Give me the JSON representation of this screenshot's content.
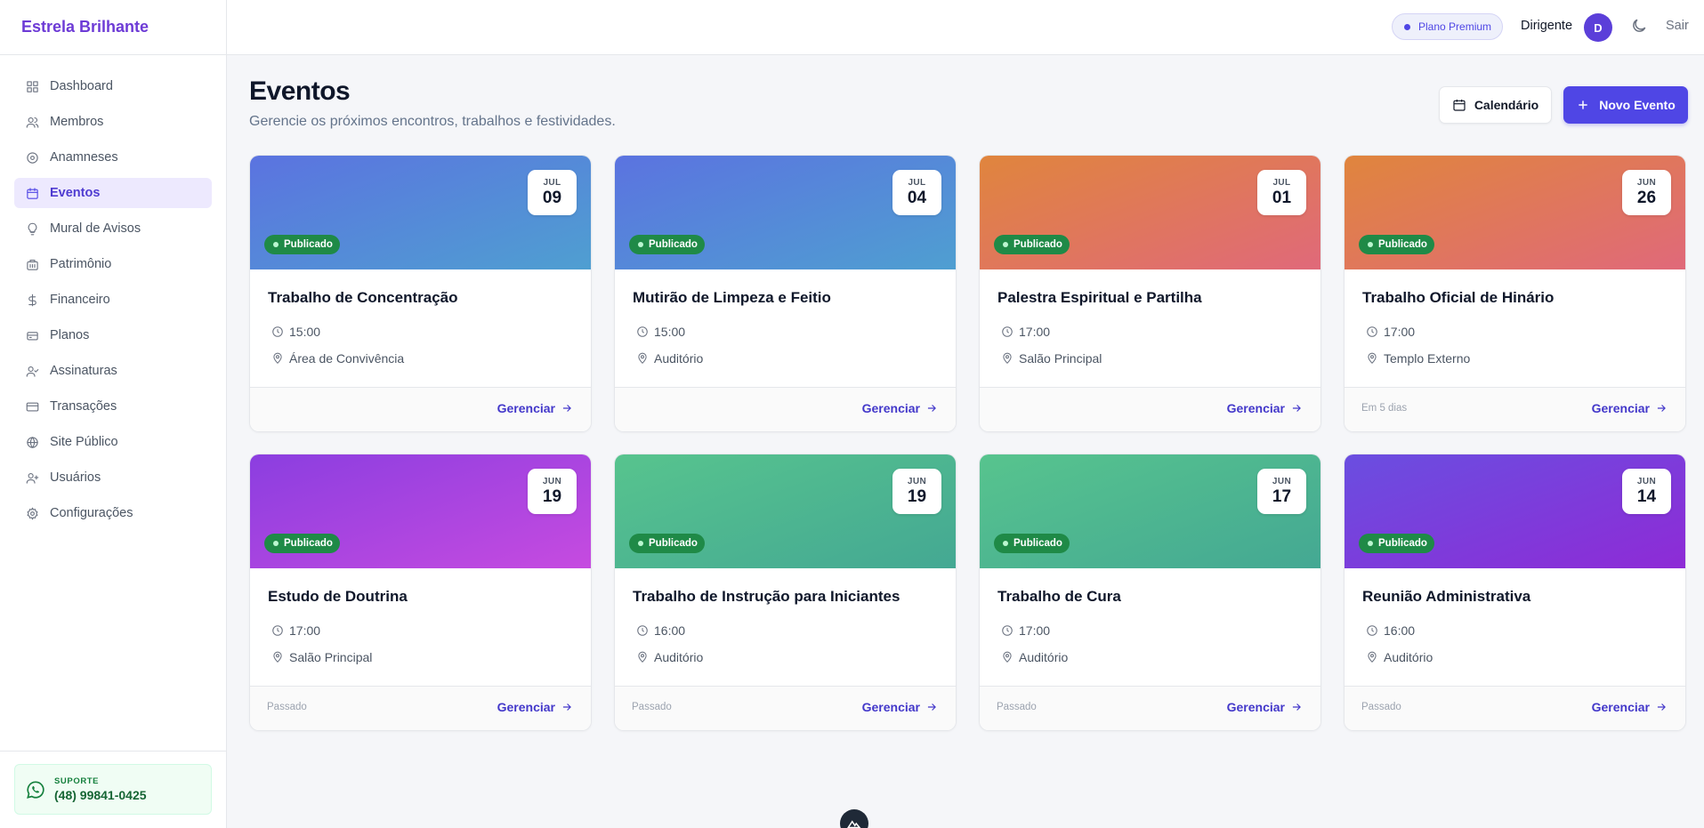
{
  "app": {
    "brand": "Estrela Brilhante"
  },
  "sidebar": {
    "items": [
      {
        "label": "Dashboard",
        "icon": "dashboard-icon"
      },
      {
        "label": "Membros",
        "icon": "users-icon"
      },
      {
        "label": "Anamneses",
        "icon": "clipboard-icon"
      },
      {
        "label": "Eventos",
        "icon": "calendar-icon",
        "active": true
      },
      {
        "label": "Mural de Avisos",
        "icon": "lightbulb-icon"
      },
      {
        "label": "Patrimônio",
        "icon": "building-icon"
      },
      {
        "label": "Financeiro",
        "icon": "dollar-icon"
      },
      {
        "label": "Planos",
        "icon": "credit-card-icon"
      },
      {
        "label": "Assinaturas",
        "icon": "user-check-icon"
      },
      {
        "label": "Transações",
        "icon": "card-icon"
      },
      {
        "label": "Site Público",
        "icon": "globe-icon"
      },
      {
        "label": "Usuários",
        "icon": "user-plus-icon"
      },
      {
        "label": "Configurações",
        "icon": "gear-icon"
      }
    ],
    "support": {
      "label": "SUPORTE",
      "phone": "(48) 99841-0425"
    }
  },
  "topbar": {
    "plan": "Plano Premium",
    "user_role": "Dirigente",
    "avatar_initial": "D",
    "logout": "Sair"
  },
  "page": {
    "title": "Eventos",
    "subtitle": "Gerencie os próximos encontros, trabalhos e festividades.",
    "calendar_button": "Calendário",
    "new_button": "Novo Evento"
  },
  "events": [
    {
      "month": "JUL",
      "day": "09",
      "status": "Publicado",
      "title": "Trabalho de Concentração",
      "time": "15:00",
      "location": "Área de Convivência",
      "note": "",
      "action": "Gerenciar",
      "gradient": [
        "#5b73e0",
        "#4f9fd1"
      ]
    },
    {
      "month": "JUL",
      "day": "04",
      "status": "Publicado",
      "title": "Mutirão de Limpeza e Feitio",
      "time": "15:00",
      "location": "Auditório",
      "note": "",
      "action": "Gerenciar",
      "gradient": [
        "#5b73e0",
        "#4f9fd1"
      ]
    },
    {
      "month": "JUL",
      "day": "01",
      "status": "Publicado",
      "title": "Palestra Espiritual e Partilha",
      "time": "17:00",
      "location": "Salão Principal",
      "note": "",
      "action": "Gerenciar",
      "gradient": [
        "#e0853d",
        "#e0697a"
      ]
    },
    {
      "month": "JUN",
      "day": "26",
      "status": "Publicado",
      "title": "Trabalho Oficial de Hinário",
      "time": "17:00",
      "location": "Templo Externo",
      "note": "Em 5 dias",
      "action": "Gerenciar",
      "gradient": [
        "#e0853d",
        "#e0697a"
      ]
    },
    {
      "month": "JUN",
      "day": "19",
      "status": "Publicado",
      "title": "Estudo de Doutrina",
      "time": "17:00",
      "location": "Salão Principal",
      "note": "Passado",
      "action": "Gerenciar",
      "gradient": [
        "#8b3ee0",
        "#c64be0"
      ]
    },
    {
      "month": "JUN",
      "day": "19",
      "status": "Publicado",
      "title": "Trabalho de Instrução para Iniciantes",
      "time": "16:00",
      "location": "Auditório",
      "note": "Passado",
      "action": "Gerenciar",
      "gradient": [
        "#57c48e",
        "#44a893"
      ]
    },
    {
      "month": "JUN",
      "day": "17",
      "status": "Publicado",
      "title": "Trabalho de Cura",
      "time": "17:00",
      "location": "Auditório",
      "note": "Passado",
      "action": "Gerenciar",
      "gradient": [
        "#57c48e",
        "#44a893"
      ]
    },
    {
      "month": "JUN",
      "day": "14",
      "status": "Publicado",
      "title": "Reunião Administrativa",
      "time": "16:00",
      "location": "Auditório",
      "note": "Passado",
      "action": "Gerenciar",
      "gradient": [
        "#6a4ee0",
        "#8e2bd6"
      ]
    }
  ]
}
